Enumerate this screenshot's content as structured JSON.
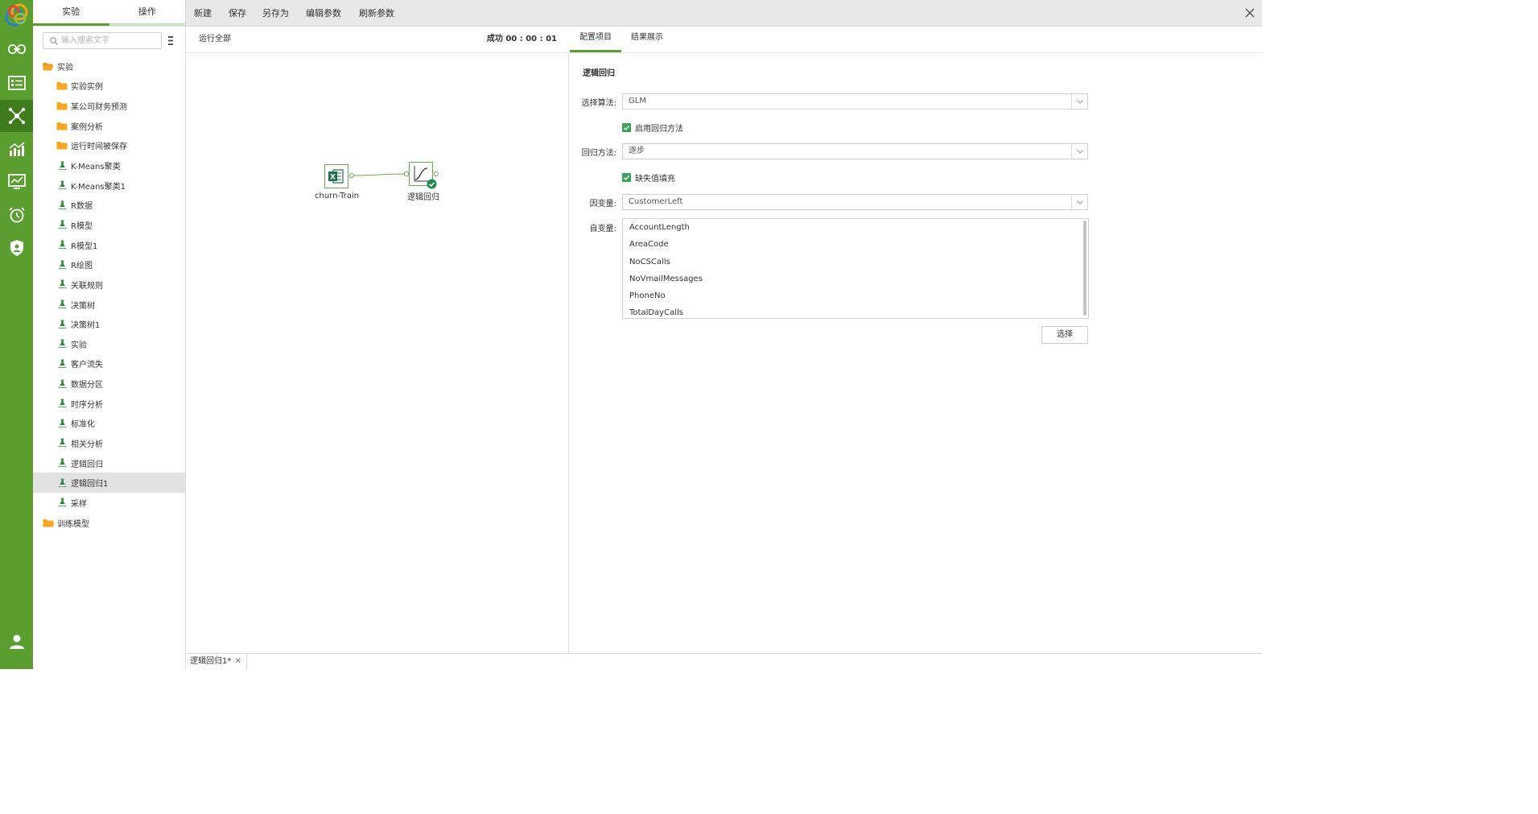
{
  "sidebar_tabs": {
    "experiment": "实验",
    "operation": "操作"
  },
  "search": {
    "placeholder": "输入搜索文字"
  },
  "tree": {
    "items": [
      {
        "label": "实验",
        "kind": "folder-open",
        "level": 0
      },
      {
        "label": "实验实例",
        "kind": "folder",
        "level": 1
      },
      {
        "label": "某公司财务预测",
        "kind": "folder",
        "level": 1
      },
      {
        "label": "案例分析",
        "kind": "folder",
        "level": 1
      },
      {
        "label": "运行时间被保存",
        "kind": "folder",
        "level": 1
      },
      {
        "label": "K-Means聚类",
        "kind": "flask",
        "level": 1
      },
      {
        "label": "K-Means聚类1",
        "kind": "flask",
        "level": 1
      },
      {
        "label": "R数据",
        "kind": "flask",
        "level": 1
      },
      {
        "label": "R模型",
        "kind": "flask",
        "level": 1
      },
      {
        "label": "R模型1",
        "kind": "flask",
        "level": 1
      },
      {
        "label": "R绘图",
        "kind": "flask",
        "level": 1
      },
      {
        "label": "关联规则",
        "kind": "flask",
        "level": 1
      },
      {
        "label": "决策树",
        "kind": "flask",
        "level": 1
      },
      {
        "label": "决策树1",
        "kind": "flask",
        "level": 1
      },
      {
        "label": "实验",
        "kind": "flask",
        "level": 1
      },
      {
        "label": "客户流失",
        "kind": "flask",
        "level": 1
      },
      {
        "label": "数据分区",
        "kind": "flask",
        "level": 1
      },
      {
        "label": "时序分析",
        "kind": "flask",
        "level": 1
      },
      {
        "label": "标准化",
        "kind": "flask",
        "level": 1
      },
      {
        "label": "相关分析",
        "kind": "flask",
        "level": 1
      },
      {
        "label": "逻辑回归",
        "kind": "flask",
        "level": 1
      },
      {
        "label": "逻辑回归1",
        "kind": "flask",
        "level": 1,
        "selected": true
      },
      {
        "label": "采样",
        "kind": "flask",
        "level": 1
      },
      {
        "label": "训练模型",
        "kind": "folder",
        "level": 0
      }
    ]
  },
  "toolbar": {
    "new": "新建",
    "save": "保存",
    "save_as": "另存为",
    "edit_params": "编辑参数",
    "refresh_params": "刷新参数"
  },
  "canvas": {
    "run_all": "运行全部",
    "status": "成功 00 : 00 : 01",
    "nodes": {
      "source": "churn-Train",
      "model": "逻辑回归"
    }
  },
  "config": {
    "tabs": {
      "config": "配置项目",
      "results": "结果展示"
    },
    "title": "逻辑回归",
    "algorithm": {
      "label": "选择算法:",
      "value": "GLM"
    },
    "enable_regression": {
      "label": "启用回归方法",
      "checked": true
    },
    "regression_method": {
      "label": "回归方法:",
      "value": "逐步"
    },
    "missing_fill": {
      "label": "缺失值填充",
      "checked": true
    },
    "dependent": {
      "label": "因变量:",
      "value": "CustomerLeft"
    },
    "independent": {
      "label": "自变量:",
      "options": [
        "AccountLength",
        "AreaCode",
        "NoCSCalls",
        "NoVmailMessages",
        "PhoneNo",
        "TotalDayCalls"
      ]
    },
    "choose_button": "选择"
  },
  "bottom_tabs": [
    {
      "label": "逻辑回归1*"
    }
  ],
  "colors": {
    "brand_green": "#5a9e2f",
    "rail_active": "#3f7d1c",
    "check_green": "#3aa35a",
    "folder_orange": "#f5a623"
  }
}
